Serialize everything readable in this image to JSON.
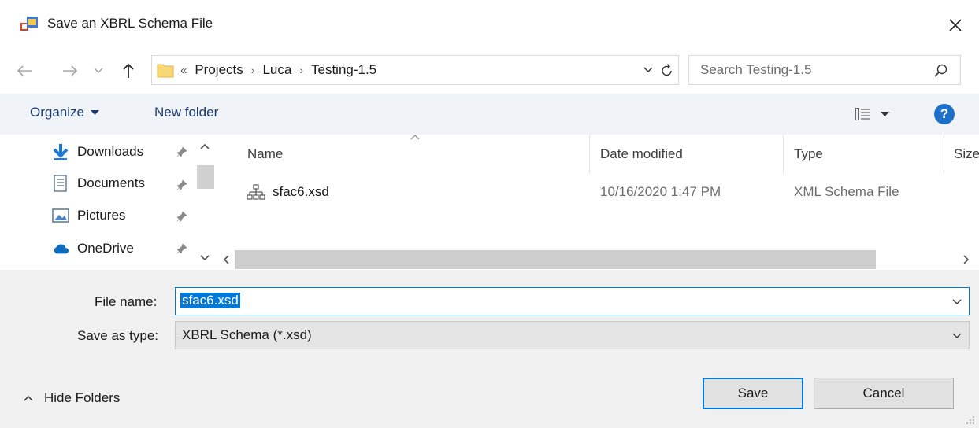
{
  "window": {
    "title": "Save an XBRL Schema File",
    "close_icon": "close-icon"
  },
  "nav": {
    "back_icon": "arrow-left-icon",
    "forward_icon": "arrow-right-icon",
    "recent_icon": "chevron-down-icon",
    "up_icon": "arrow-up-icon"
  },
  "address": {
    "overflow": "«",
    "crumbs": [
      "Projects",
      "Luca",
      "Testing-1.5"
    ],
    "separator": "›"
  },
  "search": {
    "placeholder": "Search Testing-1.5"
  },
  "toolbar": {
    "organize_label": "Organize",
    "new_folder_label": "New folder",
    "help_label": "?"
  },
  "sidebar": {
    "items": [
      {
        "label": "Downloads",
        "icon": "download-arrow-icon",
        "pinned": true
      },
      {
        "label": "Documents",
        "icon": "documents-icon",
        "pinned": true
      },
      {
        "label": "Pictures",
        "icon": "pictures-icon",
        "pinned": true
      },
      {
        "label": "OneDrive",
        "icon": "cloud-icon",
        "pinned": true
      }
    ]
  },
  "files": {
    "columns": [
      "Name",
      "Date modified",
      "Type",
      "Size"
    ],
    "rows": [
      {
        "name": "sfac6.xsd",
        "date_modified": "10/16/2020 1:47 PM",
        "type": "XML Schema File",
        "icon": "xml-schema-icon"
      }
    ]
  },
  "form": {
    "file_name_label": "File name:",
    "file_name_value": "sfac6.xsd",
    "save_as_type_label": "Save as type:",
    "save_as_type_value": "XBRL Schema (*.xsd)"
  },
  "footer": {
    "hide_folders_label": "Hide Folders",
    "save_label": "Save",
    "cancel_label": "Cancel"
  },
  "colors": {
    "accent": "#0078d7",
    "help": "#1e6fc8",
    "command_bar": "#f0f4f9",
    "bottom_panel": "#f0f0f0"
  }
}
